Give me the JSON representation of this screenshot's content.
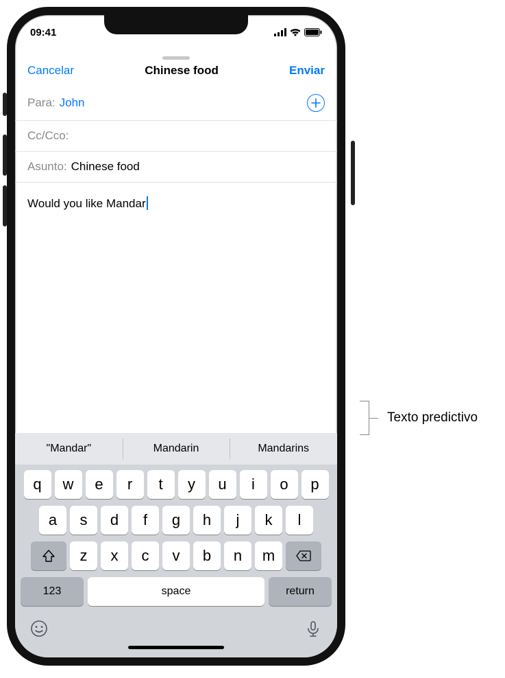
{
  "status": {
    "time": "09:41"
  },
  "header": {
    "cancel": "Cancelar",
    "title": "Chinese food",
    "send": "Enviar"
  },
  "fields": {
    "to_label": "Para:",
    "to_value": "John",
    "cc_label": "Cc/Cco:",
    "subject_label": "Asunto:",
    "subject_value": "Chinese food"
  },
  "body": {
    "text": "Would you like Mandar"
  },
  "predictive": {
    "items": [
      "\"Mandar\"",
      "Mandarin",
      "Mandarins"
    ]
  },
  "keyboard": {
    "row1": [
      "q",
      "w",
      "e",
      "r",
      "t",
      "y",
      "u",
      "i",
      "o",
      "p"
    ],
    "row2": [
      "a",
      "s",
      "d",
      "f",
      "g",
      "h",
      "j",
      "k",
      "l"
    ],
    "row3": [
      "z",
      "x",
      "c",
      "v",
      "b",
      "n",
      "m"
    ],
    "num": "123",
    "space": "space",
    "return": "return"
  },
  "callout": {
    "label": "Texto predictivo"
  }
}
